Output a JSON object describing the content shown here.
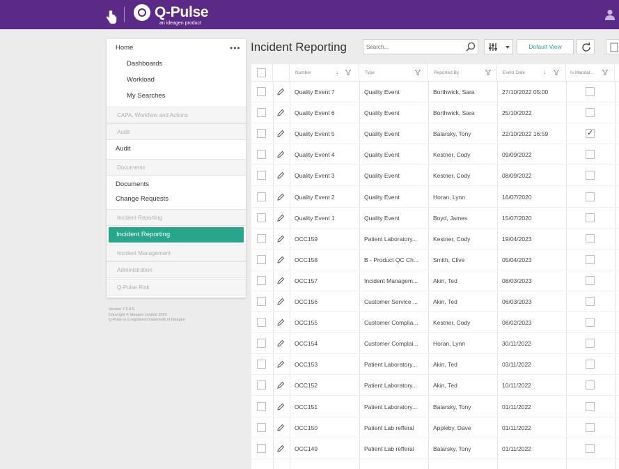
{
  "app": {
    "name": "Q-Pulse",
    "tagline": "an ideagen product"
  },
  "colors": {
    "topbar": "#5b2a86",
    "accent": "#26a68a"
  },
  "icons": [
    "hand-cursor-icon",
    "user-icon",
    "search-icon",
    "column-settings-icon",
    "chevron-down-icon",
    "refresh-icon",
    "export-icon",
    "pencil-icon",
    "sort-icon",
    "filter-icon"
  ],
  "sidebar": {
    "home": "Home",
    "more": "•••",
    "home_items": [
      "Dashboards",
      "Workload",
      "My Searches"
    ],
    "sections": {
      "capa": "CAPA, Workflow and Actions",
      "audit_header": "Audit",
      "audit": "Audit",
      "documents_header": "Documents",
      "documents": "Documents",
      "change_requests": "Change Requests",
      "incident_reporting_header": "Incident Reporting",
      "incident_reporting": "Incident Reporting",
      "incident_management": "Incident Management",
      "administration": "Administration",
      "risk": "Q-Pulse Risk"
    },
    "meta": {
      "version": "Version 7.5.0.0",
      "copyright": "Copyright © Ideagen Limited 2023",
      "trademark": "Q-Pulse is a registered trademark of Ideagen"
    }
  },
  "main": {
    "title": "Incident Reporting",
    "search_placeholder": "Search...",
    "view_button": "Default View"
  },
  "grid": {
    "columns": [
      "Number",
      "Type",
      "Reported By",
      "Event Date",
      "Is Mandat..."
    ],
    "rows": [
      {
        "number": "Quality Event 7",
        "type": "Quality Event",
        "reported_by": "Borthwick, Sara",
        "date": "27/10/2022 05:00",
        "mandatory": false
      },
      {
        "number": "Quality Event 6",
        "type": "Quality Event",
        "reported_by": "Borthwick, Sara",
        "date": "25/10/2022",
        "mandatory": false
      },
      {
        "number": "Quality Event 5",
        "type": "Quality Event",
        "reported_by": "Balarsky, Tony",
        "date": "22/10/2022 16:59",
        "mandatory": true
      },
      {
        "number": "Quality Event 4",
        "type": "Quality Event",
        "reported_by": "Kestner, Cody",
        "date": "09/09/2022",
        "mandatory": false
      },
      {
        "number": "Quality Event 3",
        "type": "Quality Event",
        "reported_by": "Kestner, Cody",
        "date": "08/09/2022",
        "mandatory": false
      },
      {
        "number": "Quality Event 2",
        "type": "Quality Event",
        "reported_by": "Horan, Lynn",
        "date": "16/07/2020",
        "mandatory": false
      },
      {
        "number": "Quality Event 1",
        "type": "Quality Event",
        "reported_by": "Boyd, James",
        "date": "15/07/2020",
        "mandatory": false
      },
      {
        "number": "OCC159",
        "type": "Patient Laboratory...",
        "reported_by": "Kestner, Cody",
        "date": "19/04/2023",
        "mandatory": false
      },
      {
        "number": "OCC158",
        "type": "B - Product QC Ch...",
        "reported_by": "Smith, Clive",
        "date": "05/04/2023",
        "mandatory": false
      },
      {
        "number": "OCC157",
        "type": "Incident Managem...",
        "reported_by": "Akin, Ted",
        "date": "08/03/2023",
        "mandatory": false
      },
      {
        "number": "OCC156",
        "type": "Customer Service ...",
        "reported_by": "Akin, Ted",
        "date": "06/03/2023",
        "mandatory": false
      },
      {
        "number": "OCC155",
        "type": "Customer Complia...",
        "reported_by": "Kestner, Cody",
        "date": "08/02/2023",
        "mandatory": false
      },
      {
        "number": "OCC154",
        "type": "Customer Complai...",
        "reported_by": "Horan, Lynn",
        "date": "30/11/2022",
        "mandatory": false
      },
      {
        "number": "OCC153",
        "type": "Patient Laboratory...",
        "reported_by": "Akin, Ted",
        "date": "03/11/2022",
        "mandatory": false
      },
      {
        "number": "OCC152",
        "type": "Patient Laboratory...",
        "reported_by": "Akin, Ted",
        "date": "10/11/2022",
        "mandatory": false
      },
      {
        "number": "OCC151",
        "type": "Patient Laboratory...",
        "reported_by": "Balarsky, Tony",
        "date": "01/11/2022",
        "mandatory": false
      },
      {
        "number": "OCC150",
        "type": "Patient Lab refferal",
        "reported_by": "Appleby, Dave",
        "date": "01/11/2022",
        "mandatory": false
      },
      {
        "number": "OCC149",
        "type": "Patient Lab refferal",
        "reported_by": "Balarsky, Tony",
        "date": "01/11/2022",
        "mandatory": false
      }
    ]
  }
}
